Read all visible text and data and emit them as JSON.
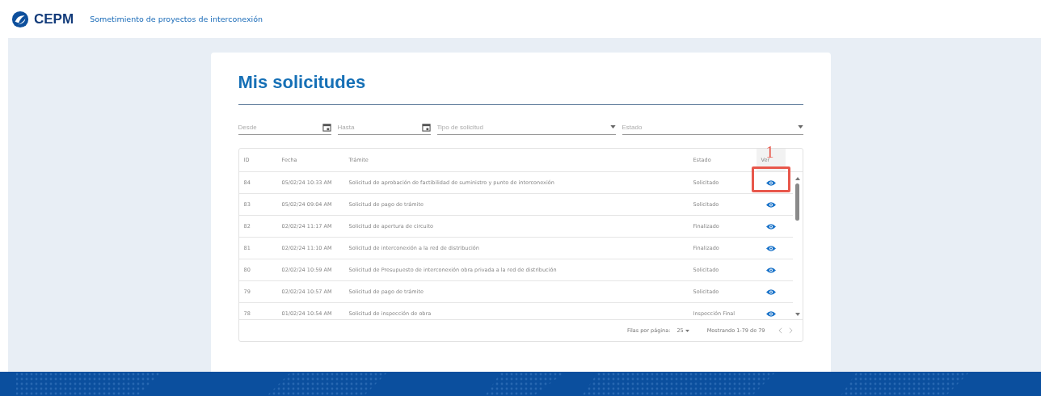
{
  "header": {
    "brand": "CEPM",
    "subtitle": "Sometimiento de proyectos de interconexión"
  },
  "page": {
    "title": "Mis solicitudes"
  },
  "filters": [
    {
      "kind": "date",
      "placeholder": "Desde"
    },
    {
      "kind": "date",
      "placeholder": "Hasta"
    },
    {
      "kind": "select",
      "placeholder": "Tipo de solicitud"
    },
    {
      "kind": "select",
      "placeholder": "Estado"
    }
  ],
  "table": {
    "columns": [
      "ID",
      "Fecha",
      "Trámite",
      "Estado",
      "Ver"
    ],
    "rows": [
      {
        "id": "84",
        "date": "05/02/24 10:33 AM",
        "procedure": "Solicitud de aprobación de factibilidad de suministro y punto de interconexión",
        "status": "Solicitado"
      },
      {
        "id": "83",
        "date": "05/02/24 09:04 AM",
        "procedure": "Solicitud de pago de trámite",
        "status": "Solicitado"
      },
      {
        "id": "82",
        "date": "02/02/24 11:17 AM",
        "procedure": "Solicitud de apertura de circuito",
        "status": "Finalizado"
      },
      {
        "id": "81",
        "date": "02/02/24 11:10 AM",
        "procedure": "Solicitud de interconexión a la red de distribución",
        "status": "Finalizado"
      },
      {
        "id": "80",
        "date": "02/02/24 10:59 AM",
        "procedure": "Solicitud de Presupuesto de interconexión obra privada a la red de distribución",
        "status": "Solicitado"
      },
      {
        "id": "79",
        "date": "02/02/24 10:57 AM",
        "procedure": "Solicitud de pago de trámite",
        "status": "Solicitado"
      },
      {
        "id": "78",
        "date": "01/02/24 10:54 AM",
        "procedure": "Solicitud de inspección de obra",
        "status": "Inspección Final"
      }
    ]
  },
  "pagination": {
    "rows_label": "Filas por página:",
    "rows_per_page": "25",
    "range": "Mostrando 1-79 de 79"
  },
  "annotation": {
    "number": "1"
  }
}
